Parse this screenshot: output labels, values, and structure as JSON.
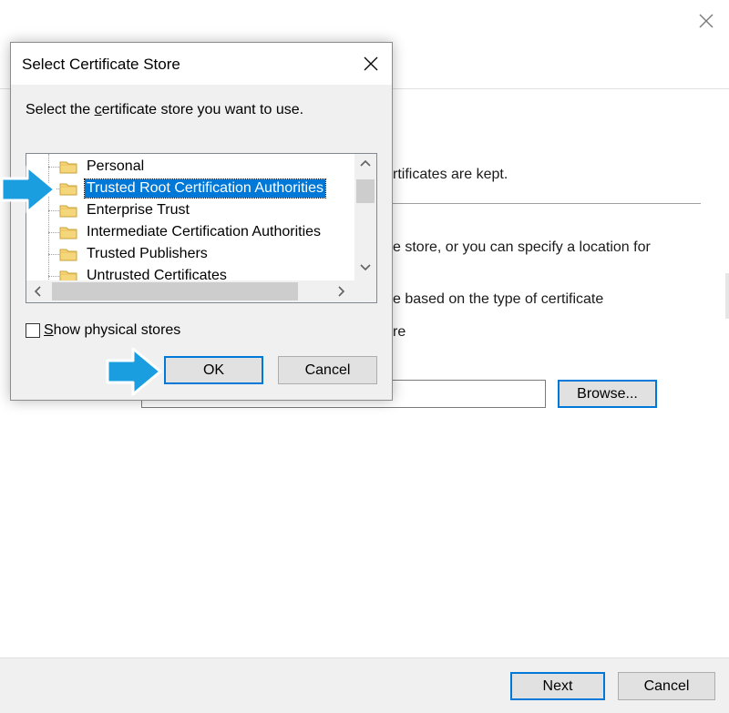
{
  "wizard": {
    "text_line1": "rtificates are kept.",
    "text_line2": "e store, or you can specify a location for",
    "text_line3": "e based on the type of certificate",
    "text_line4": "re",
    "browse_label": "Browse...",
    "next_label": "Next",
    "cancel_label": "Cancel"
  },
  "dialog": {
    "title": "Select Certificate Store",
    "prompt_pre": "Select the ",
    "prompt_underlined": "c",
    "prompt_post": "ertificate store you want to use.",
    "stores": [
      {
        "label": "Personal",
        "selected": false
      },
      {
        "label": "Trusted Root Certification Authorities",
        "selected": true
      },
      {
        "label": "Enterprise Trust",
        "selected": false
      },
      {
        "label": "Intermediate Certification Authorities",
        "selected": false
      },
      {
        "label": "Trusted Publishers",
        "selected": false
      },
      {
        "label": "Untrusted Certificates",
        "selected": false
      }
    ],
    "show_physical_underlined": "S",
    "show_physical_rest": "how physical stores",
    "show_physical_checked": false,
    "ok_label": "OK",
    "cancel_label": "Cancel"
  },
  "icons": {
    "close": "close-icon",
    "folder": "folder-icon",
    "scroll_up": "chevron-up-icon",
    "scroll_down": "chevron-down-icon",
    "scroll_left": "chevron-left-icon",
    "scroll_right": "chevron-right-icon",
    "pointer": "arrow-right-icon"
  },
  "colors": {
    "selection": "#0078d7",
    "arrow": "#1a9ee0",
    "dialog_bg": "#f0f0f0"
  }
}
